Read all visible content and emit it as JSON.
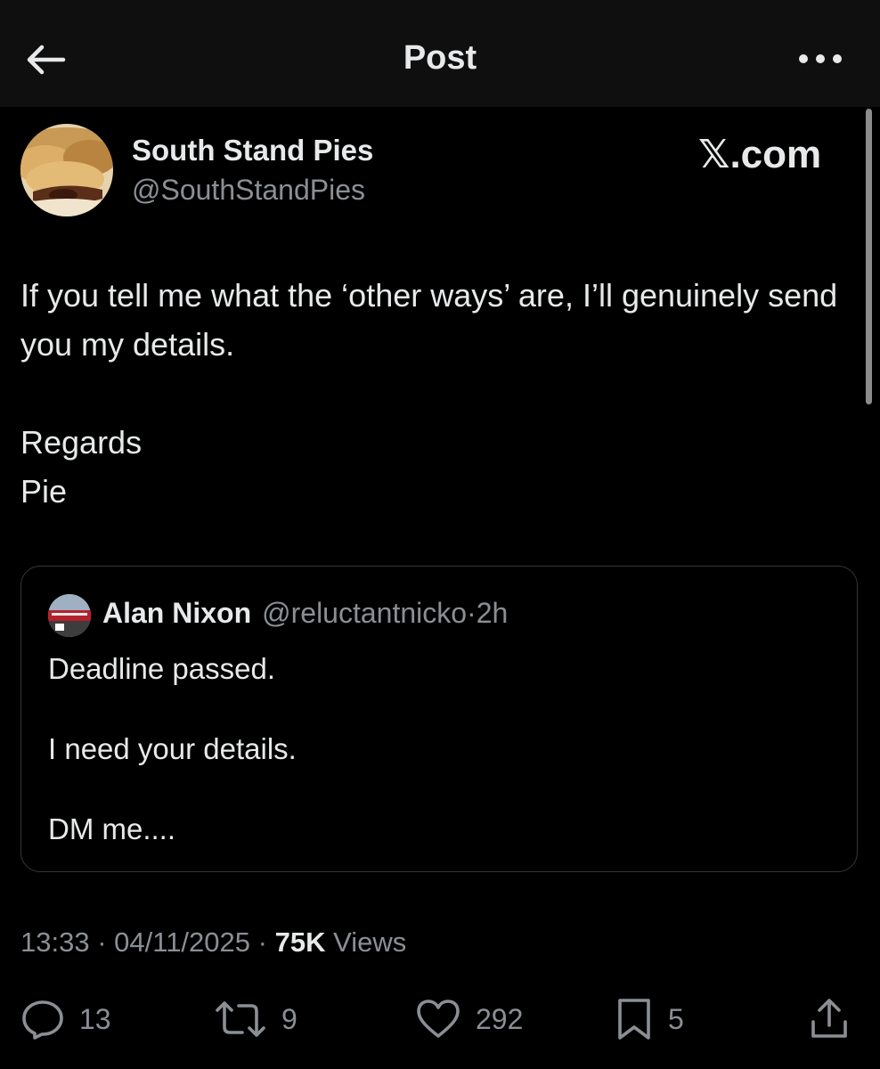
{
  "header": {
    "title": "Post",
    "back_icon": "arrow-left-icon",
    "more_icon": "more-horizontal-icon"
  },
  "post": {
    "author_name": "South Stand Pies",
    "author_handle": "@SouthStandPies",
    "watermark": "𝕏.com",
    "lines": [
      "If you tell me what the ‘other ways’ are, I’ll genuinely send you my details.",
      "Regards",
      "Pie"
    ]
  },
  "quoted_post": {
    "author_name": "Alan Nixon",
    "author_handle": "@reluctantnicko",
    "separator": "·",
    "time": "2h",
    "lines": [
      "Deadline passed.",
      "I need your details.",
      "DM me...."
    ]
  },
  "meta": {
    "time": "13:33",
    "separator": "·",
    "date": "04/11/2025",
    "views_count": "75K",
    "views_label": "Views"
  },
  "actions": {
    "replies": {
      "icon": "reply-icon",
      "count": "13"
    },
    "reposts": {
      "icon": "repost-icon",
      "count": "9"
    },
    "likes": {
      "icon": "heart-icon",
      "count": "292"
    },
    "bookmarks": {
      "icon": "bookmark-icon",
      "count": "5"
    },
    "share": {
      "icon": "share-icon"
    }
  },
  "colors": {
    "background": "#000000",
    "header_background": "#0f0f0f",
    "primary_text": "#e7e9ea",
    "secondary_text": "#8b8f94",
    "border": "#333639"
  }
}
